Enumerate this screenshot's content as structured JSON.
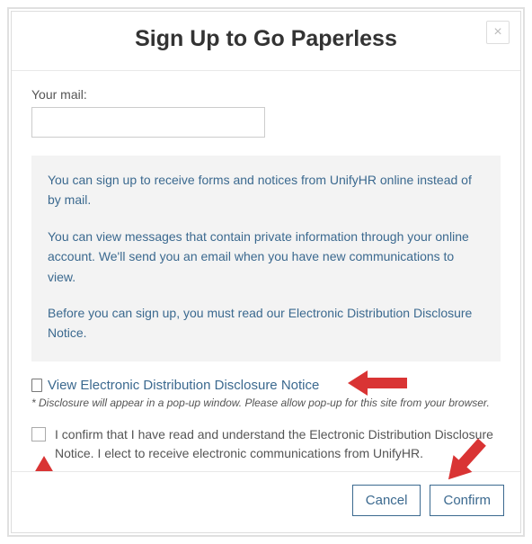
{
  "modal": {
    "title": "Sign Up to Go Paperless",
    "close_label": "×"
  },
  "form": {
    "mail_label": "Your mail:",
    "mail_value": ""
  },
  "info": {
    "para1": "You can sign up to receive forms and notices from UnifyHR online instead of by mail.",
    "para2": "You can view messages that contain private information through your online account. We'll send you an email when you have new communications to view.",
    "para3": "Before you can sign up, you must read our Electronic Distribution Disclosure Notice."
  },
  "disclosure": {
    "link_text": "View Electronic Distribution Disclosure Notice",
    "disclaimer": "* Disclosure will appear in a pop-up window. Please allow pop-up for this site from your browser."
  },
  "confirm": {
    "text": "I confirm that I have read and understand the Electronic Distribution Disclosure Notice. I elect to receive electronic communications from UnifyHR.",
    "checked": false
  },
  "buttons": {
    "cancel": "Cancel",
    "confirm": "Confirm"
  },
  "annotations": {
    "arrow_color": "#d93434"
  }
}
